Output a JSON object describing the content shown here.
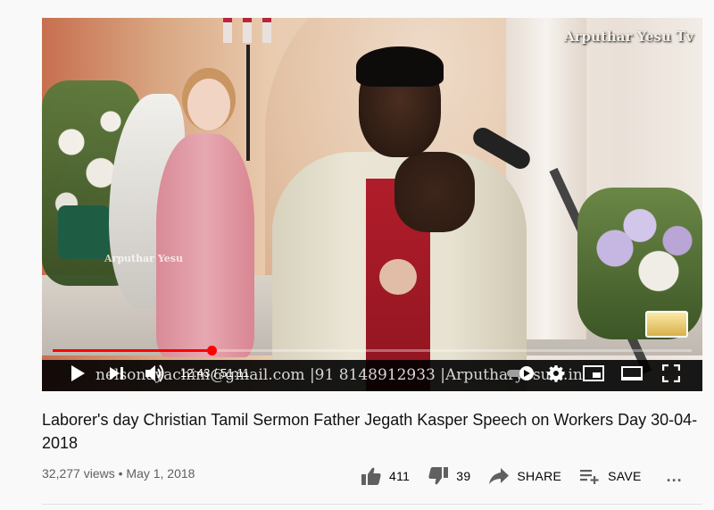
{
  "player": {
    "watermark": "Arputhar Yesu Tv",
    "watermark_small": "Arputhar Yesu",
    "ticker_text": "nelsonayachim@gmail.com |91 8148912933 |Arputharyesutv.in",
    "time_display": "12:43 / 51:11",
    "progress_fraction": 0.248,
    "icons": {
      "play": "play-icon",
      "next": "next-icon",
      "volume": "volume-icon",
      "autoplay": "autoplay-toggle-icon",
      "settings": "gear-icon",
      "miniplayer": "miniplayer-icon",
      "theater": "theater-icon",
      "fullscreen": "fullscreen-icon"
    },
    "colors": {
      "progress": "#ff0000"
    }
  },
  "video": {
    "title": "Laborer's day Christian Tamil Sermon Father Jegath Kasper Speech on Workers Day 30-04-2018",
    "views": "32,277 views",
    "separator": "•",
    "date": "May 1, 2018"
  },
  "actions": {
    "likes": "411",
    "dislikes": "39",
    "share_label": "SHARE",
    "save_label": "SAVE",
    "more_label": "..."
  }
}
